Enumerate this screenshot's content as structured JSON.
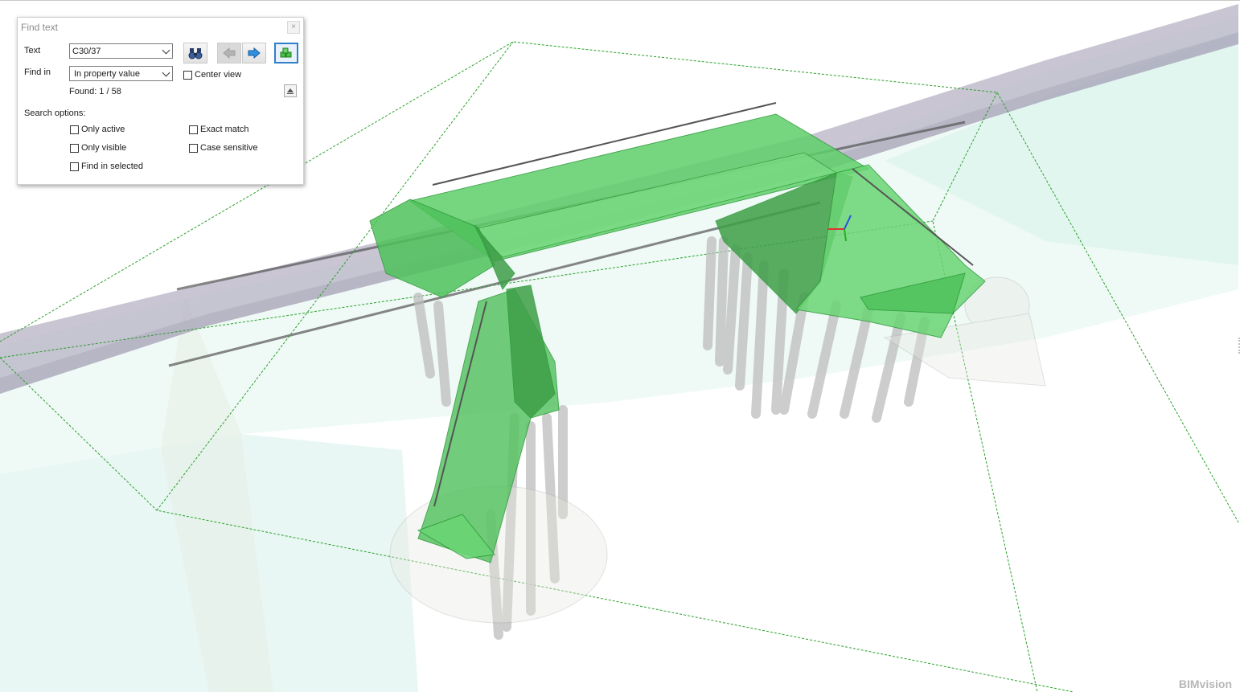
{
  "find_dialog": {
    "title": "Find text",
    "close_glyph": "×",
    "text_label": "Text",
    "text_value": "C30/37",
    "find_in_label": "Find in",
    "find_in_value": "In property value",
    "center_view_label": "Center view",
    "found_text": "Found: 1 / 58",
    "search_options_label": "Search options:",
    "options": {
      "only_active": "Only active",
      "only_visible": "Only visible",
      "find_in_selected": "Find in selected",
      "exact_match": "Exact match",
      "case_sensitive": "Case sensitive"
    },
    "buttons": {
      "find": "binoculars-icon",
      "previous": "arrow-left-icon",
      "next": "arrow-right-icon",
      "select_all": "select-found-icon"
    }
  },
  "viewport": {
    "highlight_color": "#5fd06a",
    "edge_color": "#2e9a3a",
    "bbox_color": "#2aa12a",
    "axis_colors": {
      "x": "#e53030",
      "y": "#22b022",
      "z": "#2a4ee0"
    }
  },
  "watermark": "BIMvision"
}
